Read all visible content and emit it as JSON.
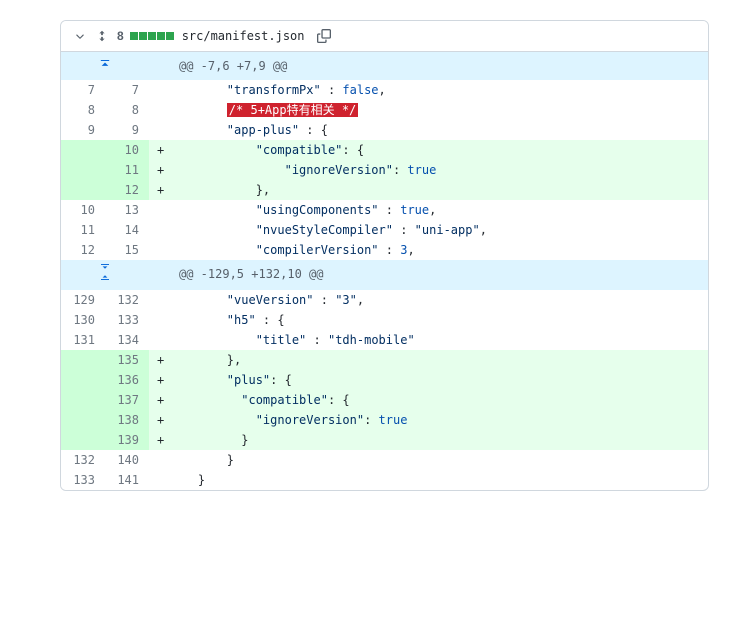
{
  "file": {
    "path": "src/manifest.json",
    "additions_count": "8"
  },
  "hunks": [
    {
      "header": "@@ -7,6 +7,9 @@"
    },
    {
      "header": "@@ -129,5 +132,10 @@"
    }
  ],
  "rows": {
    "r1": {
      "old": "7",
      "new": "7",
      "html": "        <span class='tok-str'>\"transformPx\"</span> : <span class='tok-bool'>false</span>,"
    },
    "r2": {
      "old": "8",
      "new": "8",
      "html": "        <span class='hl-red'>/* 5+App特有相关 */</span>"
    },
    "r3": {
      "old": "9",
      "new": "9",
      "html": "        <span class='tok-str'>\"app-plus\"</span> : {"
    },
    "r4": {
      "old": "",
      "new": "10",
      "marker": "+",
      "html": "            <span class='tok-str'>\"compatible\"</span>: {"
    },
    "r5": {
      "old": "",
      "new": "11",
      "marker": "+",
      "html": "                <span class='tok-str'>\"ignoreVersion\"</span>: <span class='tok-bool'>true</span>"
    },
    "r6": {
      "old": "",
      "new": "12",
      "marker": "+",
      "html": "            },"
    },
    "r7": {
      "old": "10",
      "new": "13",
      "html": "            <span class='tok-str'>\"usingComponents\"</span> : <span class='tok-bool'>true</span>,"
    },
    "r8": {
      "old": "11",
      "new": "14",
      "html": "            <span class='tok-str'>\"nvueStyleCompiler\"</span> : <span class='tok-str'>\"uni-app\"</span>,"
    },
    "r9": {
      "old": "12",
      "new": "15",
      "html": "            <span class='tok-str'>\"compilerVersion\"</span> : <span class='tok-num'>3</span>,"
    },
    "r10": {
      "old": "129",
      "new": "132",
      "html": "        <span class='tok-str'>\"vueVersion\"</span> : <span class='tok-str'>\"3\"</span>,"
    },
    "r11": {
      "old": "130",
      "new": "133",
      "html": "        <span class='tok-str'>\"h5\"</span> : {"
    },
    "r12": {
      "old": "131",
      "new": "134",
      "html": "            <span class='tok-str'>\"title\"</span> : <span class='tok-str'>\"tdh-mobile\"</span>"
    },
    "r13": {
      "old": "",
      "new": "135",
      "marker": "+",
      "html": "        },"
    },
    "r14": {
      "old": "",
      "new": "136",
      "marker": "+",
      "html": "        <span class='tok-str'>\"plus\"</span>: {"
    },
    "r15": {
      "old": "",
      "new": "137",
      "marker": "+",
      "html": "          <span class='tok-str'>\"compatible\"</span>: {"
    },
    "r16": {
      "old": "",
      "new": "138",
      "marker": "+",
      "html": "            <span class='tok-str'>\"ignoreVersion\"</span>: <span class='tok-bool'>true</span>"
    },
    "r17": {
      "old": "",
      "new": "139",
      "marker": "+",
      "html": "          }"
    },
    "r18": {
      "old": "132",
      "new": "140",
      "html": "        }"
    },
    "r19": {
      "old": "133",
      "new": "141",
      "html": "    }"
    }
  }
}
